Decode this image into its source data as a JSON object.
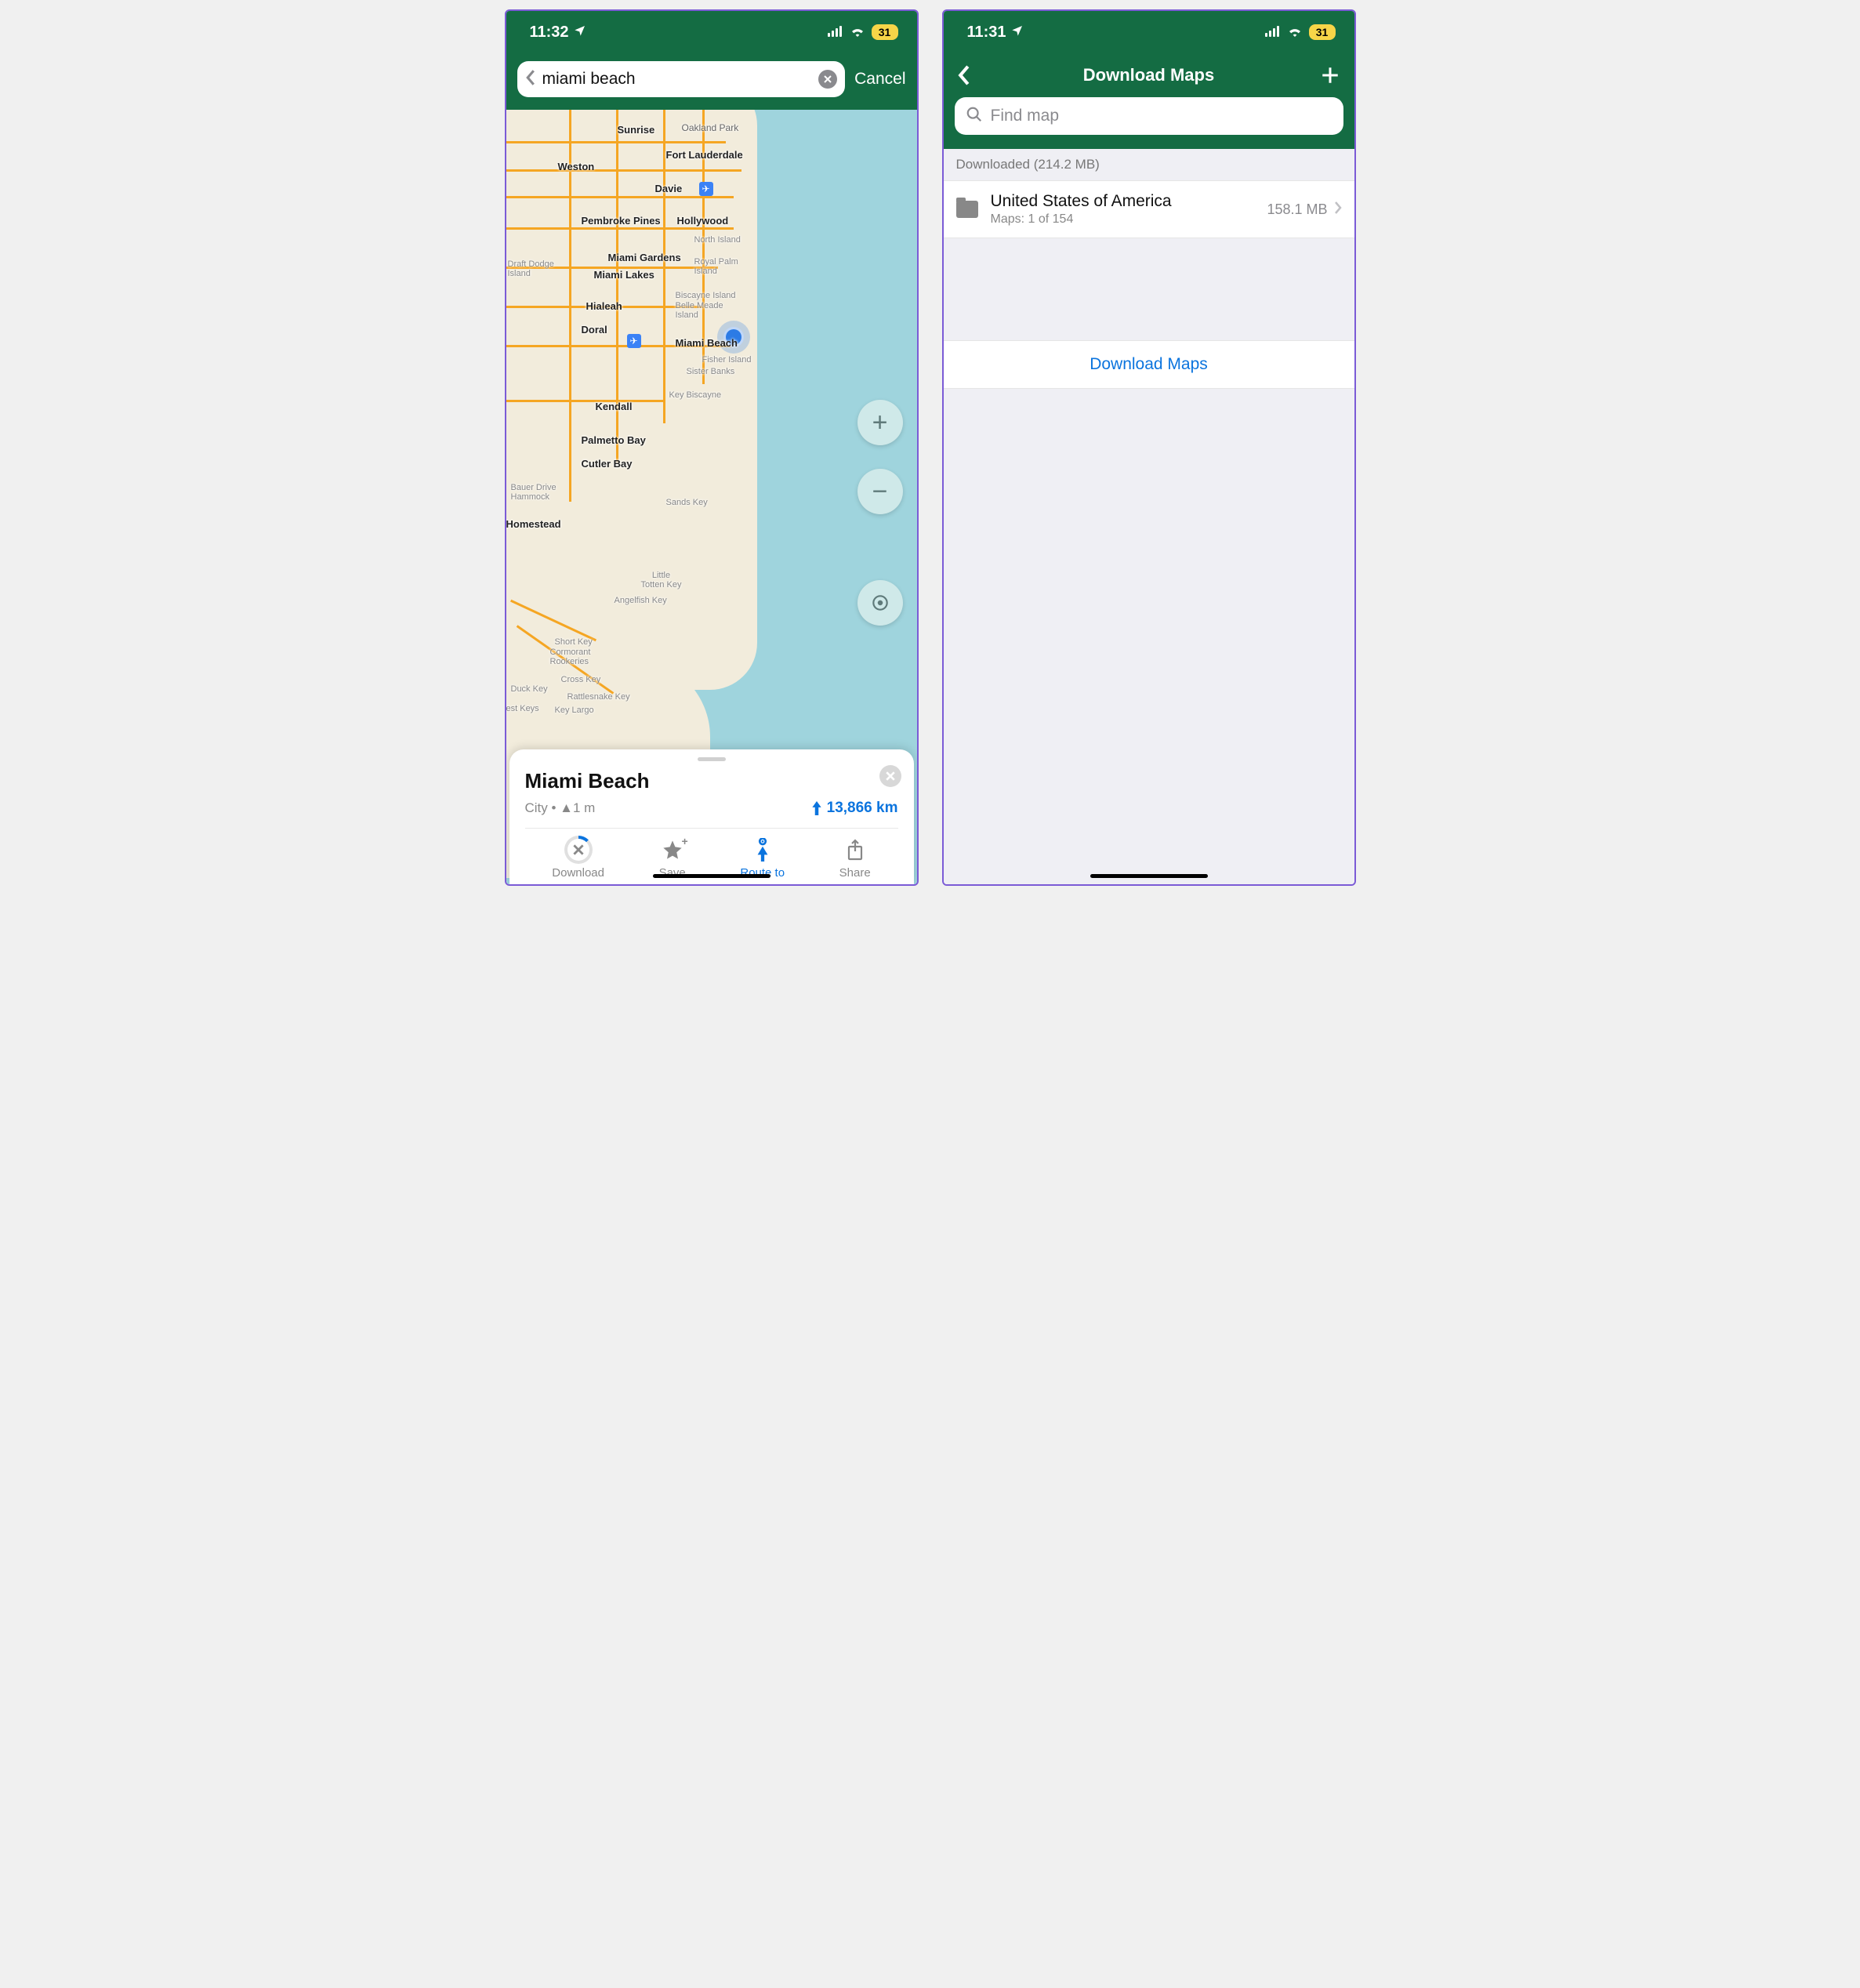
{
  "left": {
    "status": {
      "time": "11:32",
      "battery": "31"
    },
    "search": {
      "value": "miami beach",
      "cancel": "Cancel"
    },
    "map_labels": {
      "sunrise": "Sunrise",
      "oakland_park": "Oakland Park",
      "fort_lauderdale": "Fort Lauderdale",
      "weston": "Weston",
      "davie": "Davie",
      "pembroke_pines": "Pembroke Pines",
      "hollywood": "Hollywood",
      "north_island": "North Island",
      "draft_dodge": "Draft Dodge\nIsland",
      "miami_gardens": "Miami Gardens",
      "royal_palm": "Royal Palm\nIsland",
      "miami_lakes": "Miami Lakes",
      "biscayne_island": "Biscayne Island",
      "belle_meade": "Belle Meade\nIsland",
      "hialeah": "Hialeah",
      "doral": "Doral",
      "miami_beach": "Miami Beach",
      "fisher_island": "Fisher Island",
      "sister_banks": "Sister Banks",
      "key_biscayne": "Key Biscayne",
      "kendall": "Kendall",
      "palmetto_bay": "Palmetto Bay",
      "cutler_bay": "Cutler Bay",
      "bauer_drive": "Bauer Drive\nHammock",
      "sands_key": "Sands Key",
      "homestead": "Homestead",
      "little_totten": "Little\nTotten Key",
      "angelfish": "Angelfish Key",
      "short_key": "Short Key",
      "cormorant": "Cormorant\nRookeries",
      "cross_key": "Cross Key",
      "duck_key": "Duck Key",
      "rattlesnake": "Rattlesnake Key",
      "est_keys": "est Keys",
      "key_largo": "Key Largo"
    },
    "sheet": {
      "title": "Miami Beach",
      "subtitle": "City • ▲1 m",
      "distance": "13,866 km",
      "download": "Download",
      "save": "Save",
      "route_to": "Route to",
      "share": "Share"
    }
  },
  "right": {
    "status": {
      "time": "11:31",
      "battery": "31"
    },
    "nav_title": "Download Maps",
    "find_placeholder": "Find map",
    "section": "Downloaded (214.2 MB)",
    "row": {
      "title": "United States of America",
      "sub": "Maps: 1 of 154",
      "size": "158.1 MB"
    },
    "link": "Download Maps"
  }
}
